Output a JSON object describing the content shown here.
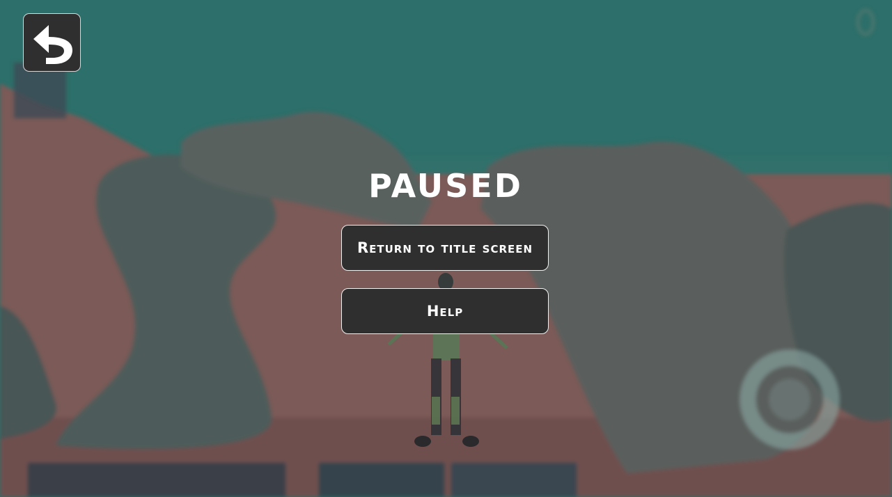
{
  "pause_menu": {
    "title": "PAUSED",
    "buttons": {
      "return_label": "Return to title screen",
      "help_label": "Help"
    }
  },
  "controls": {
    "back_icon": "undo-arrow-icon",
    "joystick": "virtual-joystick"
  },
  "colors": {
    "sky": "#2d6f6a",
    "sand": "#7d5c58",
    "rock": "#4f5b5a",
    "button_bg": "#2f2f2f",
    "button_border": "#f2f2f2",
    "text": "#ffffff"
  }
}
